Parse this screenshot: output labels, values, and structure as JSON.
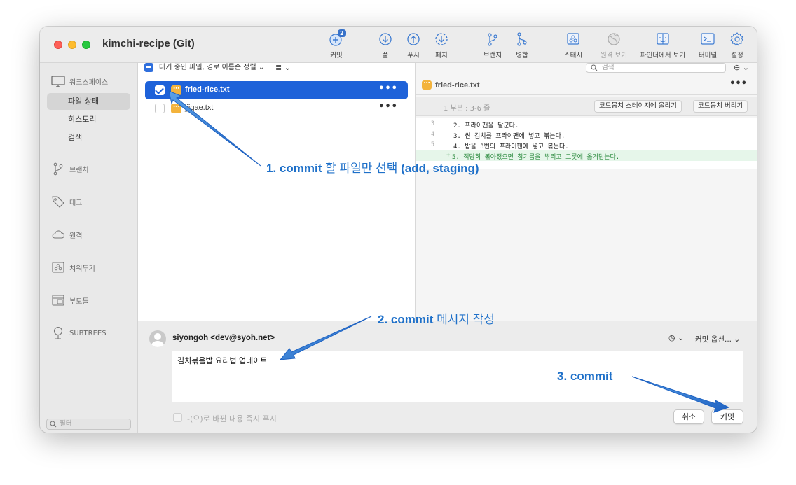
{
  "window": {
    "title": "kimchi-recipe (Git)"
  },
  "toolbar": {
    "items": [
      {
        "label": "커밋",
        "badge": "2",
        "icon": "commit-plus-icon"
      },
      {
        "label": "풀",
        "icon": "pull-icon"
      },
      {
        "label": "푸시",
        "icon": "push-icon"
      },
      {
        "label": "페치",
        "icon": "fetch-icon"
      },
      {
        "label": "브랜치",
        "icon": "branch-icon"
      },
      {
        "label": "병합",
        "icon": "merge-icon"
      },
      {
        "label": "스태시",
        "icon": "stash-icon"
      },
      {
        "label": "원격 보기",
        "icon": "globe-icon",
        "disabled": true
      },
      {
        "label": "파인더에서 보기",
        "icon": "finder-icon"
      },
      {
        "label": "터미널",
        "icon": "terminal-icon"
      },
      {
        "label": "설정",
        "icon": "gear-icon"
      }
    ]
  },
  "sidebar": {
    "workspace": "워크스페이스",
    "items": [
      "파일 상태",
      "히스토리",
      "검색"
    ],
    "active_index": 0,
    "sections": [
      "브랜치",
      "태그",
      "원격",
      "치워두기",
      "부모들",
      "SUBTREES"
    ],
    "filter_placeholder": "필터"
  },
  "filepane": {
    "sort_label": "대기 중인 파일, 경로 이름순 정렬",
    "view_mode": "≣",
    "files": [
      {
        "name": "fried-rice.txt",
        "checked": true,
        "selected": true
      },
      {
        "name": "jjigae.txt",
        "checked": false,
        "selected": false
      }
    ]
  },
  "diffpane": {
    "search_placeholder": "검색",
    "more_label": "⊖",
    "file_name": "fried-rice.txt",
    "hunk_label": "1 부분 : 3-6 줄",
    "stage_hunk": "코드뭉치 스테이지에 올리기",
    "discard_hunk": "코드뭉치 버리기",
    "lines": [
      {
        "num": "3",
        "text": "2. 프라이팬을 달군다.",
        "added": false
      },
      {
        "num": "4",
        "text": "3. 썬 김치를 프라이팬에 넣고 볶는다.",
        "added": false
      },
      {
        "num": "5",
        "text": "4. 밥을 3번의 프라이팬에 넣고 볶는다.",
        "added": false
      },
      {
        "num": "",
        "text": "5. 적당히 볶아졌으면 참기름을 뿌리고 그릇에 옮겨담는다.",
        "added": true
      }
    ]
  },
  "commit": {
    "author": "siyongoh <dev@syoh.net>",
    "history_icon": "◷",
    "options_label": "커밋 옵션...",
    "message": "김치볶음밥 요리법 업데이트",
    "push_label": "-(으)로 바뀐 내용 즉시 푸시",
    "cancel_label": "취소",
    "commit_label": "커밋"
  },
  "annotations": {
    "step1_bold": "1. commit",
    "step1_text": " 할 파일만 선택 ",
    "step1_tail": "(add, staging)",
    "step2_bold": "2. commit",
    "step2_text": " 메시지 작성",
    "step3": "3. commit",
    "color": "#1e70c9"
  }
}
